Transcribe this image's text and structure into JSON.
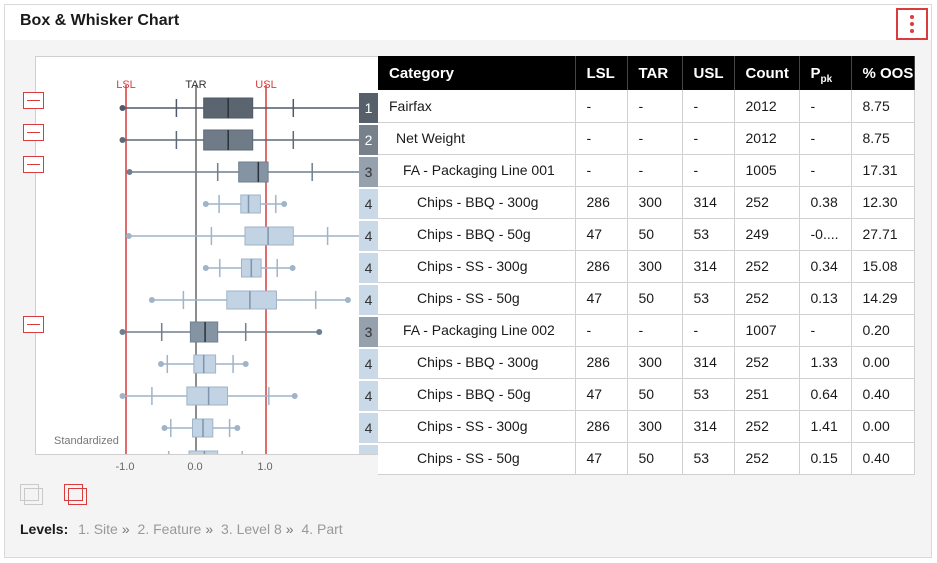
{
  "card": {
    "title": "Box & Whisker Chart"
  },
  "table": {
    "headers": {
      "category": "Category",
      "lsl": "LSL",
      "tar": "TAR",
      "usl": "USL",
      "count": "Count",
      "ppk_main": "P",
      "ppk_sub": "pk",
      "oos": "% OOS"
    },
    "rows": [
      {
        "level": "1",
        "category": "Fairfax",
        "lsl": "-",
        "tar": "-",
        "usl": "-",
        "count": "2012",
        "ppk": "-",
        "oos": "8.75"
      },
      {
        "level": "2",
        "category": "Net Weight",
        "lsl": "-",
        "tar": "-",
        "usl": "-",
        "count": "2012",
        "ppk": "-",
        "oos": "8.75"
      },
      {
        "level": "3",
        "category": "FA - Packaging Line 001",
        "lsl": "-",
        "tar": "-",
        "usl": "-",
        "count": "1005",
        "ppk": "-",
        "oos": "17.31"
      },
      {
        "level": "4",
        "category": "Chips - BBQ - 300g",
        "lsl": "286",
        "tar": "300",
        "usl": "314",
        "count": "252",
        "ppk": "0.38",
        "oos": "12.30"
      },
      {
        "level": "4",
        "category": "Chips - BBQ - 50g",
        "lsl": "47",
        "tar": "50",
        "usl": "53",
        "count": "249",
        "ppk": "-0....",
        "oos": "27.71"
      },
      {
        "level": "4",
        "category": "Chips - SS - 300g",
        "lsl": "286",
        "tar": "300",
        "usl": "314",
        "count": "252",
        "ppk": "0.34",
        "oos": "15.08"
      },
      {
        "level": "4",
        "category": "Chips - SS - 50g",
        "lsl": "47",
        "tar": "50",
        "usl": "53",
        "count": "252",
        "ppk": "0.13",
        "oos": "14.29"
      },
      {
        "level": "3",
        "category": "FA - Packaging Line 002",
        "lsl": "-",
        "tar": "-",
        "usl": "-",
        "count": "1007",
        "ppk": "-",
        "oos": "0.20"
      },
      {
        "level": "4",
        "category": "Chips - BBQ - 300g",
        "lsl": "286",
        "tar": "300",
        "usl": "314",
        "count": "252",
        "ppk": "1.33",
        "oos": "0.00"
      },
      {
        "level": "4",
        "category": "Chips - BBQ - 50g",
        "lsl": "47",
        "tar": "50",
        "usl": "53",
        "count": "251",
        "ppk": "0.64",
        "oos": "0.40"
      },
      {
        "level": "4",
        "category": "Chips - SS - 300g",
        "lsl": "286",
        "tar": "300",
        "usl": "314",
        "count": "252",
        "ppk": "1.41",
        "oos": "0.00"
      },
      {
        "level": "4",
        "category": "Chips - SS - 50g",
        "lsl": "47",
        "tar": "50",
        "usl": "53",
        "count": "252",
        "ppk": "0.15",
        "oos": "0.40"
      }
    ]
  },
  "chart_data": {
    "type": "boxplot",
    "orientation": "horizontal",
    "scale_label": "Standardized",
    "xlim": [
      -1.15,
      2.45
    ],
    "xticks": [
      -1.0,
      0.0,
      1.0
    ],
    "xtick_labels": [
      "-1.0",
      "0.0",
      "1.0"
    ],
    "reference_lines": [
      {
        "name": "LSL",
        "value": -1.0,
        "color": "#d93c3c"
      },
      {
        "name": "TAR",
        "value": 0.0,
        "color": "#1a1a1a"
      },
      {
        "name": "USL",
        "value": 1.0,
        "color": "#d93c3c"
      }
    ],
    "series": [
      {
        "category": "Fairfax",
        "level": 1,
        "min": -1.05,
        "p5": -0.28,
        "q1": 0.11,
        "median": 0.46,
        "q3": 0.81,
        "p95": 1.39,
        "max": 2.46
      },
      {
        "category": "Net Weight",
        "level": 2,
        "min": -1.05,
        "p5": -0.28,
        "q1": 0.11,
        "median": 0.46,
        "q3": 0.81,
        "p95": 1.39,
        "max": 2.46
      },
      {
        "category": "FA - Packaging Line 001",
        "level": 3,
        "min": -0.95,
        "p5": 0.31,
        "q1": 0.61,
        "median": 0.89,
        "q3": 1.03,
        "p95": 1.66,
        "max": 2.46
      },
      {
        "category": "Chips - BBQ - 300g",
        "level": 4,
        "min": 0.14,
        "p5": 0.33,
        "q1": 0.64,
        "median": 0.75,
        "q3": 0.92,
        "p95": 1.14,
        "max": 1.26
      },
      {
        "category": "Chips - BBQ - 50g",
        "level": 4,
        "min": -0.96,
        "p5": 0.22,
        "q1": 0.7,
        "median": 1.03,
        "q3": 1.39,
        "p95": 1.88,
        "max": 2.4
      },
      {
        "category": "Chips - SS - 300g",
        "level": 4,
        "min": 0.14,
        "p5": 0.34,
        "q1": 0.65,
        "median": 0.79,
        "q3": 0.93,
        "p95": 1.16,
        "max": 1.38
      },
      {
        "category": "Chips - SS - 50g",
        "level": 4,
        "min": -0.63,
        "p5": -0.18,
        "q1": 0.44,
        "median": 0.77,
        "q3": 1.15,
        "p95": 1.71,
        "max": 2.17
      },
      {
        "category": "FA - Packaging Line 002",
        "level": 3,
        "min": -1.05,
        "p5": -0.49,
        "q1": -0.08,
        "median": 0.13,
        "q3": 0.31,
        "p95": 0.71,
        "max": 1.76
      },
      {
        "category": "Chips - BBQ - 300g",
        "level": 4,
        "min": -0.5,
        "p5": -0.41,
        "q1": -0.03,
        "median": 0.11,
        "q3": 0.28,
        "p95": 0.53,
        "max": 0.71
      },
      {
        "category": "Chips - BBQ - 50g",
        "level": 4,
        "min": -1.05,
        "p5": -0.63,
        "q1": -0.13,
        "median": 0.18,
        "q3": 0.45,
        "p95": 1.04,
        "max": 1.41
      },
      {
        "category": "Chips - SS - 300g",
        "level": 4,
        "min": -0.45,
        "p5": -0.36,
        "q1": -0.05,
        "median": 0.1,
        "q3": 0.24,
        "p95": 0.48,
        "max": 0.59
      },
      {
        "category": "Chips - SS - 50g",
        "level": 4,
        "min": -0.58,
        "p5": -0.39,
        "q1": -0.1,
        "median": 0.12,
        "q3": 0.31,
        "p95": 0.66,
        "max": 0.95
      }
    ],
    "level_colors": {
      "1": {
        "box": "#5a6570",
        "line": "#50596a",
        "badge": "#55606b"
      },
      "2": {
        "box": "#6f7b87",
        "line": "#5e6977",
        "badge": "#76818c"
      },
      "3": {
        "box": "#8594a2",
        "line": "#6f7f8e",
        "badge": "#95a2ae"
      },
      "4": {
        "box": "#c2d3e4",
        "line": "#9fb4c9",
        "badge": "#c9d9e8"
      }
    }
  },
  "footer": {
    "levels_label": "Levels:",
    "levels": [
      "1. Site",
      "2. Feature",
      "3. Level 8",
      "4. Part"
    ],
    "separator": "»"
  }
}
